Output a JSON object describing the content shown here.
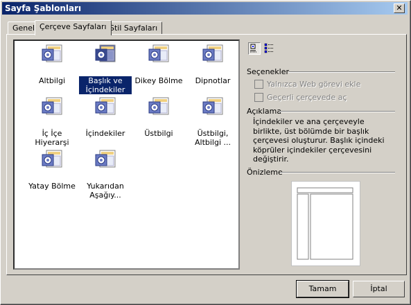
{
  "window": {
    "title": "Sayfa Şablonları",
    "close_glyph": "✕"
  },
  "tabs": [
    {
      "label": "Genel",
      "active": false
    },
    {
      "label": "Çerçeve Sayfaları",
      "active": true
    },
    {
      "label": "Stil Sayfaları",
      "active": false
    }
  ],
  "templates": [
    {
      "label": "Altbilgi",
      "selected": false
    },
    {
      "label": "Başlık ve İçindekiler",
      "selected": true
    },
    {
      "label": "Dikey Bölme",
      "selected": false
    },
    {
      "label": "Dipnotlar",
      "selected": false
    },
    {
      "label": "İç İçe Hiyerarşi",
      "selected": false
    },
    {
      "label": "İçindekiler",
      "selected": false
    },
    {
      "label": "Üstbilgi",
      "selected": false
    },
    {
      "label": "Üstbilgi, Altbilgi ...",
      "selected": false
    },
    {
      "label": "Yatay Bölme",
      "selected": false
    },
    {
      "label": "Yukarıdan Aşağıy...",
      "selected": false
    }
  ],
  "view_toggle": {
    "large_icons": "large-icons-view-icon",
    "list": "list-view-icon",
    "active": "large_icons"
  },
  "options": {
    "header": "Seçenekler",
    "web_only": {
      "label": "Yalnızca Web görevi ekle",
      "checked": false,
      "enabled": false
    },
    "current_frame": {
      "label": "Geçerli çerçevede aç",
      "checked": false,
      "enabled": false
    }
  },
  "description": {
    "header": "Açıklama",
    "text": "İçindekiler ve ana çerçeveyle birlikte, üst bölümde bir başlık çerçevesi oluşturur. Başlık içindeki köprüler içindekiler çerçevesini değiştirir."
  },
  "preview": {
    "header": "Önizleme"
  },
  "buttons": {
    "ok": "Tamam",
    "cancel": "İptal"
  },
  "colors": {
    "title_bar": "#0a246a",
    "selection": "#0a246a",
    "dialog_bg": "#d4d0c8"
  }
}
